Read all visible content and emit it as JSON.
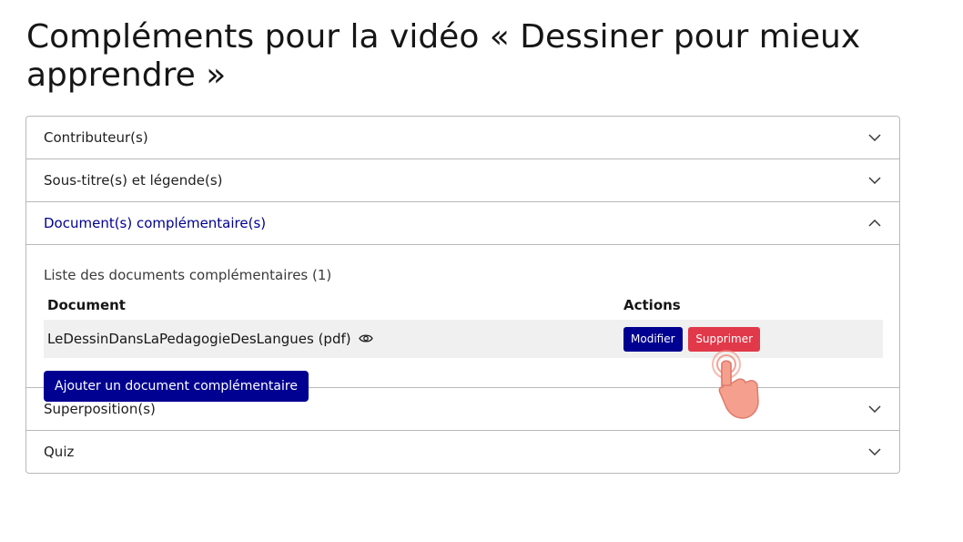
{
  "page": {
    "title": "Compléments pour la vidéo « Dessiner pour mieux apprendre »"
  },
  "accordion": {
    "contributors": {
      "label": "Contributeur(s)",
      "icon": "chevron-down-icon"
    },
    "subtitles": {
      "label": "Sous-titre(s) et légende(s)",
      "icon": "chevron-down-icon"
    },
    "documents": {
      "label": "Document(s) complémentaire(s)",
      "icon": "chevron-up-icon",
      "list_caption": "Liste des documents complémentaires (1)",
      "table": {
        "headers": {
          "document": "Document",
          "actions": "Actions"
        },
        "rows": [
          {
            "document": "LeDessinDansLaPedagogieDesLangues (pdf)",
            "view_icon": "eye-icon",
            "modify_label": "Modifier",
            "delete_label": "Supprimer"
          }
        ]
      },
      "add_button_label": "Ajouter un document complémentaire"
    },
    "overlays": {
      "label": "Superposition(s)",
      "icon": "chevron-down-icon"
    },
    "quiz": {
      "label": "Quiz",
      "icon": "chevron-down-icon"
    }
  },
  "colors": {
    "primary": "#000091",
    "danger": "#e1394a",
    "border": "#b9b9b9",
    "row_background": "#f0f0f0",
    "cursor_hand": "#f08a7a"
  },
  "cursor": {
    "icon": "hand-pointer-icon"
  }
}
